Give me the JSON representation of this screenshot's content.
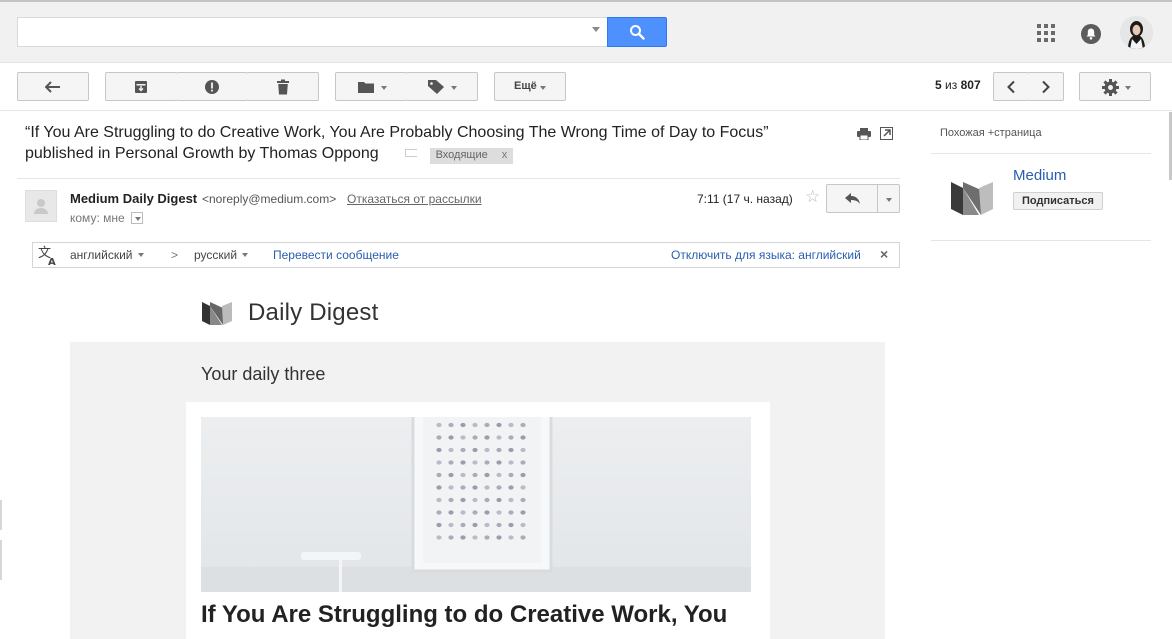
{
  "header": {
    "search": {
      "value": "",
      "placeholder": ""
    },
    "icons": [
      "search-icon",
      "apps-icon",
      "notifications-icon",
      "avatar"
    ]
  },
  "toolbar": {
    "more_label": "Ещё",
    "pager": {
      "current": "5",
      "sep": "из",
      "total": "807"
    },
    "icons": [
      "back-arrow-icon",
      "archive-icon",
      "spam-icon",
      "trash-icon",
      "folder-icon",
      "tag-icon",
      "chevron-left-icon",
      "chevron-right-icon",
      "gear-icon"
    ]
  },
  "message": {
    "subject_line1": "“If You Are Struggling to do Creative Work, You Are Probably Choosing The Wrong Time of Day to Focus”",
    "subject_line2": "published in Personal Growth by Thomas Oppong",
    "label": "Входящие",
    "label_remove": "x",
    "sender_name": "Medium Daily Digest",
    "sender_email": "<noreply@medium.com>",
    "unsubscribe": "Отказаться от рассылки",
    "to_label": "кому: мне",
    "time": "7:11 (17 ч. назад)"
  },
  "translate": {
    "from_lang": "английский",
    "arrow": ">",
    "to_lang": "русский",
    "translate_link": "Перевести сообщение",
    "disable_link": "Отключить для языка: английский",
    "close": "×"
  },
  "side_panel": {
    "title": "Похожая +страница",
    "name": "Medium",
    "subscribe": "Подписаться"
  },
  "email_body": {
    "brand_title": "Daily Digest",
    "section_title": "Your daily three",
    "article_title": "If You Are Struggling to do Creative Work, You"
  },
  "colors": {
    "accent_blue": "#4d90fe",
    "link_blue": "#2a5db0",
    "panel_gray": "#f2f2f2"
  }
}
